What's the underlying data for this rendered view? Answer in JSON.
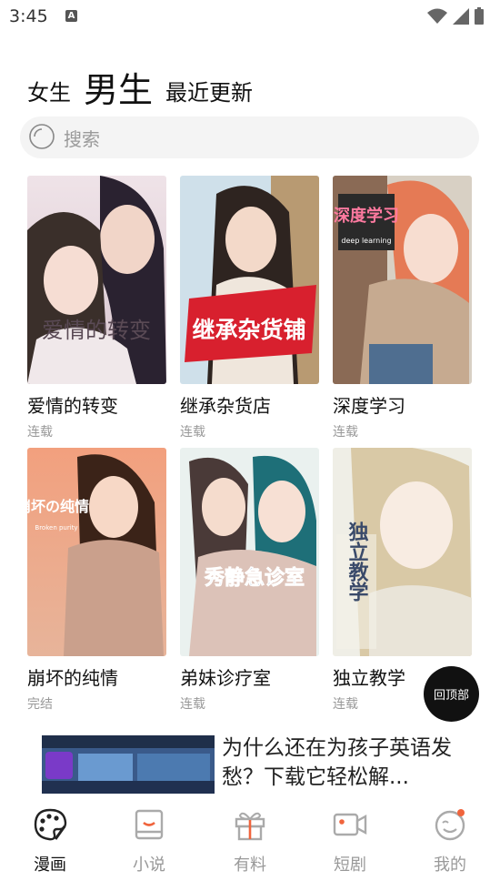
{
  "status_bar": {
    "time": "3:45",
    "notif_letter": "A"
  },
  "top_tabs": [
    {
      "label": "女生"
    },
    {
      "label": "男生"
    },
    {
      "label": "最近更新"
    }
  ],
  "search": {
    "placeholder": "搜索"
  },
  "comics": [
    {
      "title": "爱情的转变",
      "status": "连载",
      "cover_text": "爱情的转变"
    },
    {
      "title": "继承杂货店",
      "status": "连载",
      "cover_text": "继承杂货铺"
    },
    {
      "title": "深度学习",
      "status": "连载",
      "cover_text": "深度学习",
      "cover_subtext": "deep learning"
    },
    {
      "title": "崩坏的纯情",
      "status": "完结",
      "cover_text": "崩坏の纯情",
      "cover_subtext": "Broken purity"
    },
    {
      "title": "弟妹诊疗室",
      "status": "连载",
      "cover_text": "秀静急诊室"
    },
    {
      "title": "独立教学",
      "status": "连载",
      "cover_text": "独立教学"
    }
  ],
  "back_to_top": "回顶部",
  "ad": {
    "text": "为什么还在为孩子英语发愁？下载它轻松解..."
  },
  "bottom_nav": [
    {
      "label": "漫画",
      "icon": "palette-icon",
      "active": true
    },
    {
      "label": "小说",
      "icon": "book-icon",
      "active": false
    },
    {
      "label": "有料",
      "icon": "gift-icon",
      "active": false
    },
    {
      "label": "短剧",
      "icon": "video-camera-icon",
      "active": false
    },
    {
      "label": "我的",
      "icon": "user-face-icon",
      "active": false
    }
  ],
  "colors": {
    "accent": "#f0643c",
    "text": "#111111",
    "muted": "#999999",
    "search_bg": "#f4f4f4"
  }
}
